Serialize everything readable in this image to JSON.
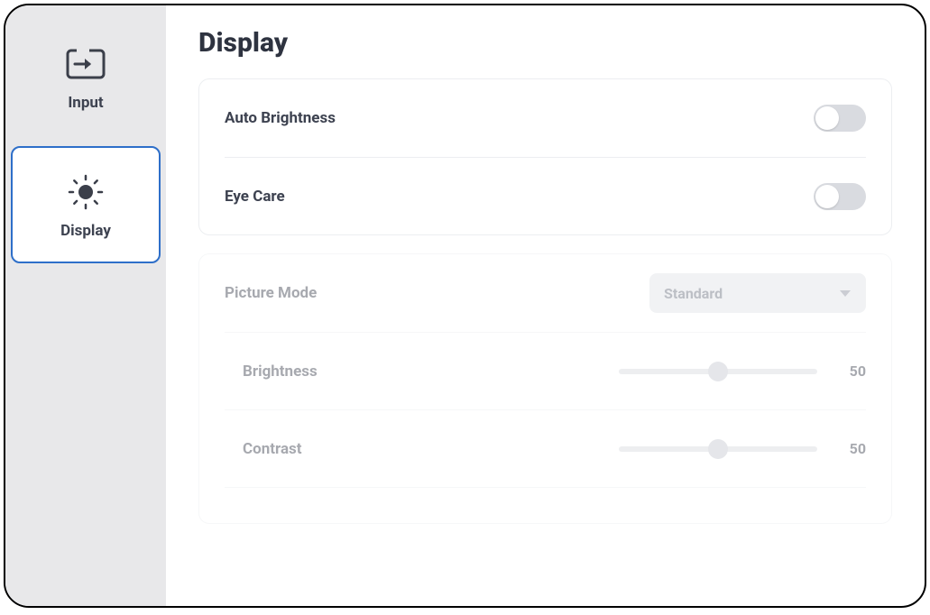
{
  "page": {
    "title": "Display"
  },
  "sidebar": {
    "items": [
      {
        "label": "Input",
        "selected": false
      },
      {
        "label": "Display",
        "selected": true
      }
    ]
  },
  "settings": {
    "auto_brightness": {
      "label": "Auto Brightness",
      "value": false
    },
    "eye_care": {
      "label": "Eye Care",
      "value": false
    },
    "picture_mode": {
      "label": "Picture Mode",
      "value": "Standard"
    },
    "brightness": {
      "label": "Brightness",
      "value": 50,
      "min": 0,
      "max": 100
    },
    "contrast": {
      "label": "Contrast",
      "value": 50,
      "min": 0,
      "max": 100
    }
  },
  "colors": {
    "accent": "#2e6fc9",
    "text": "#3d4250",
    "panel_border": "#eceef1",
    "toggle_off": "#d9dbe0"
  }
}
